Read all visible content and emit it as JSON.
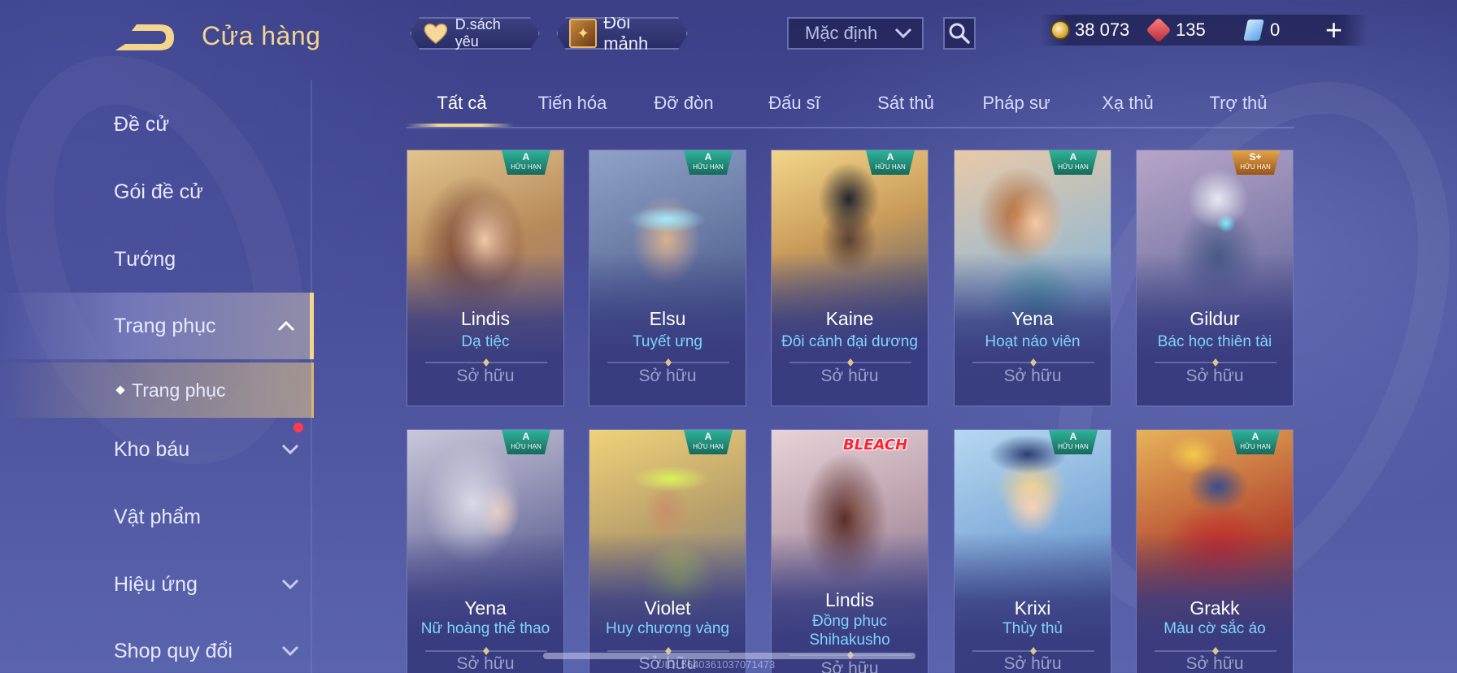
{
  "header": {
    "title": "Cửa hàng",
    "favorites_label": "D.sách yêu",
    "swap_label": "Đổi mảnh",
    "sort_selected": "Mặc định",
    "currency": {
      "gold": "38 073",
      "vouchers": "135",
      "tickets": "0"
    }
  },
  "sidebar": {
    "items": [
      {
        "label": "Đề cử"
      },
      {
        "label": "Gói đề cử"
      },
      {
        "label": "Tướng"
      },
      {
        "label": "Trang phục"
      },
      {
        "label": "Trang phục"
      },
      {
        "label": "Kho báu"
      },
      {
        "label": "Vật phẩm"
      },
      {
        "label": "Hiệu ứng"
      },
      {
        "label": "Shop quy đổi"
      }
    ]
  },
  "tabs": [
    "Tất cả",
    "Tiến hóa",
    "Đỡ đòn",
    "Đấu sĩ",
    "Sát thủ",
    "Pháp sư",
    "Xạ thủ",
    "Trợ thủ"
  ],
  "cards": [
    {
      "hero": "Lindis",
      "skin": "Dạ tiệc",
      "status": "Sở hữu",
      "grade": "A",
      "tag": "HỮU HẠN"
    },
    {
      "hero": "Elsu",
      "skin": "Tuyết ưng",
      "status": "Sở hữu",
      "grade": "A",
      "tag": "HỮU HẠN"
    },
    {
      "hero": "Kaine",
      "skin": "Đôi cánh đại dương",
      "status": "Sở hữu",
      "grade": "A",
      "tag": "HỮU HẠN"
    },
    {
      "hero": "Yena",
      "skin": "Hoạt náo viên",
      "status": "Sở hữu",
      "grade": "A",
      "tag": "HỮU HẠN"
    },
    {
      "hero": "Gildur",
      "skin": "Bác học thiên tài",
      "status": "Sở hữu",
      "grade": "S+",
      "tag": "HỮU HẠN"
    },
    {
      "hero": "Yena",
      "skin": "Nữ hoàng thể thao",
      "status": "Sở hữu",
      "grade": "A",
      "tag": "HỮU HẠN"
    },
    {
      "hero": "Violet",
      "skin": "Huy chương vàng",
      "status": "Sở hữu",
      "grade": "A",
      "tag": "HỮU HẠN"
    },
    {
      "hero": "Lindis",
      "skin": "Đồng phục Shihakusho",
      "status": "Sở hữu",
      "collab": "BLEACH"
    },
    {
      "hero": "Krixi",
      "skin": "Thủy thủ",
      "status": "Sở hữu",
      "grade": "A",
      "tag": "HỮU HẠN"
    },
    {
      "hero": "Grakk",
      "skin": "Màu cờ sắc áo",
      "status": "Sở hữu",
      "grade": "A",
      "tag": "HỮU HẠN"
    }
  ],
  "footer": {
    "uid": "UID: 5640361037071473"
  },
  "colors": {
    "accent_gold": "#f3d58e",
    "skin_name": "#7fd3ff",
    "badge_green": "#2fb39a",
    "badge_gold": "#e3a34a"
  }
}
